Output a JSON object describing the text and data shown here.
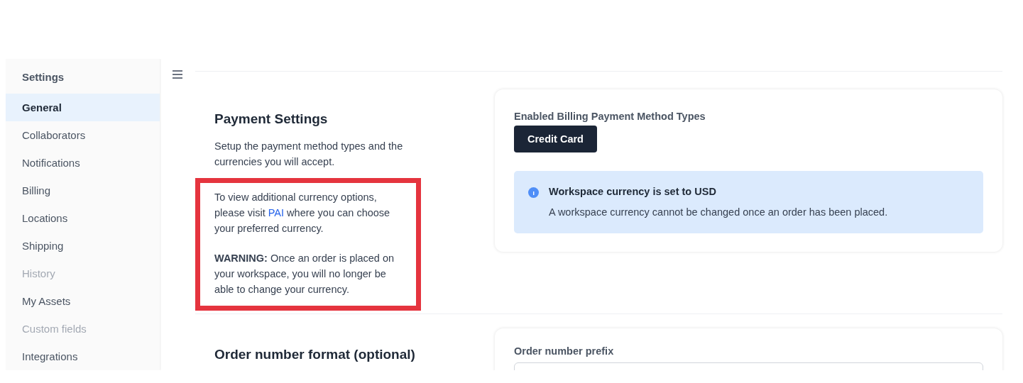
{
  "sidebar": {
    "title": "Settings",
    "items": [
      {
        "label": "General",
        "selected": true,
        "disabled": false
      },
      {
        "label": "Collaborators",
        "selected": false,
        "disabled": false
      },
      {
        "label": "Notifications",
        "selected": false,
        "disabled": false
      },
      {
        "label": "Billing",
        "selected": false,
        "disabled": false
      },
      {
        "label": "Locations",
        "selected": false,
        "disabled": false
      },
      {
        "label": "Shipping",
        "selected": false,
        "disabled": false
      },
      {
        "label": "History",
        "selected": false,
        "disabled": true
      },
      {
        "label": "My Assets",
        "selected": false,
        "disabled": false
      },
      {
        "label": "Custom fields",
        "selected": false,
        "disabled": true
      },
      {
        "label": "Integrations",
        "selected": false,
        "disabled": false
      }
    ]
  },
  "payment_settings": {
    "title": "Payment Settings",
    "description": "Setup the payment method types and the currencies you will accept.",
    "note_before_link": "To view additional currency options, please visit ",
    "note_link": "PAI",
    "note_after_link": " where you can choose your preferred currency.",
    "warning": "**WARNING:** Once an order is placed on your workspace, you will no longer be able to change your currency.",
    "highlighted": true,
    "methods_label": "Enabled Billing Payment Method Types",
    "methods": [
      "Credit Card"
    ],
    "alert": {
      "title": "Workspace currency is set to USD",
      "message": "A workspace currency cannot be changed once an order has been placed."
    }
  },
  "order_number": {
    "title": "Order number format (optional)",
    "prefix_label": "Order number prefix"
  }
}
